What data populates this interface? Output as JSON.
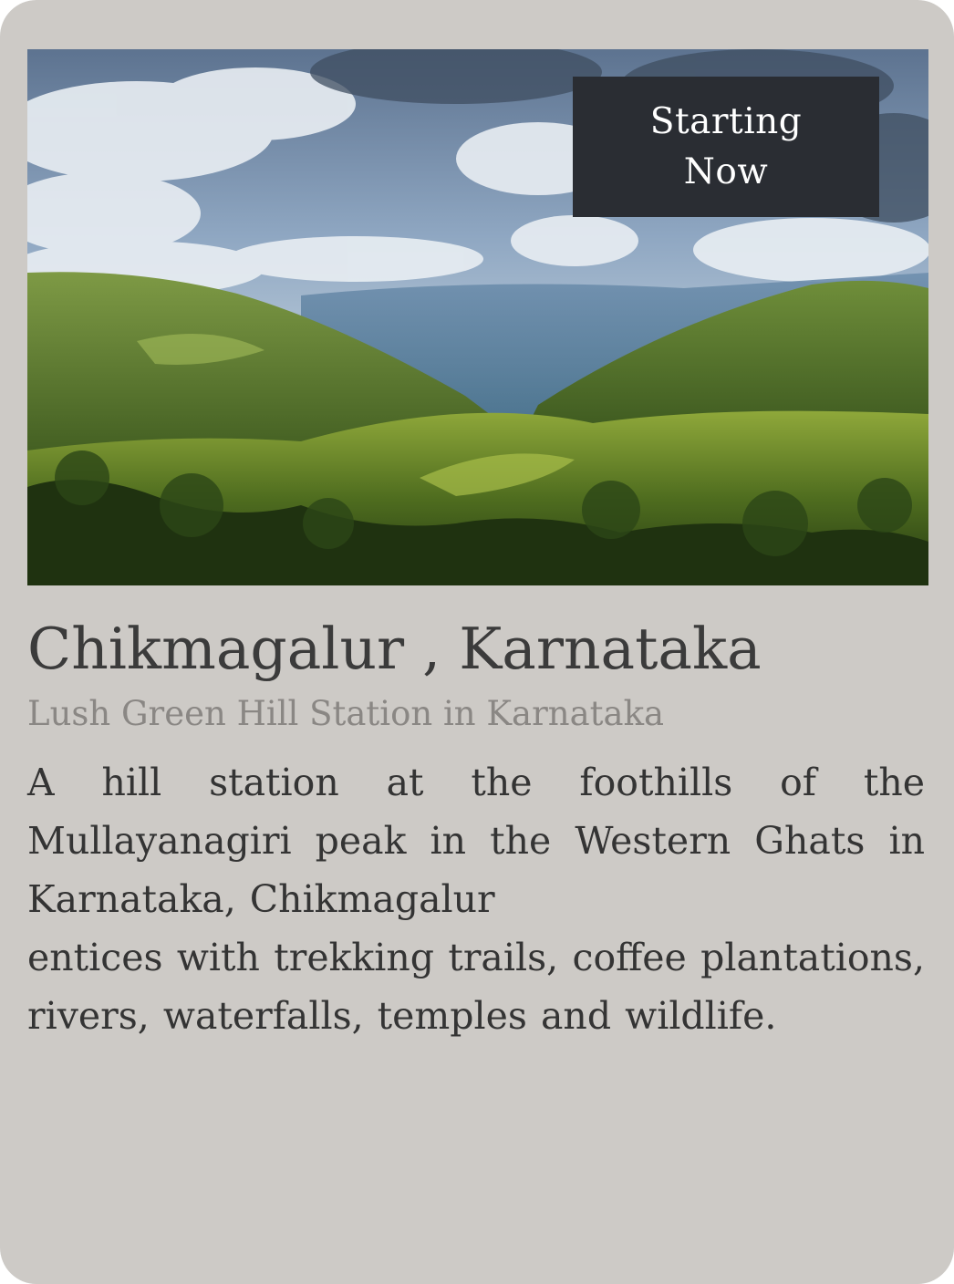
{
  "card": {
    "image_alt": "Green hills and valleys under a cloudy sky",
    "badge": "Starting Now",
    "title": "Chikmagalur , Karnataka",
    "subtitle": "Lush Green Hill Station in Karnataka",
    "description_line1": "A hill station at the foothills of the Mullayanagiri peak in the Western Ghats in Karnataka, Chikmagalur",
    "description_line2": "entices with trekking trails, coffee plantations, rivers, waterfalls, temples and wildlife."
  },
  "colors": {
    "card_background": "#cdcac6",
    "badge_background": "#2a2d33",
    "title": "#3b3b3b",
    "subtitle": "#8a8784",
    "body_text": "#343434"
  }
}
